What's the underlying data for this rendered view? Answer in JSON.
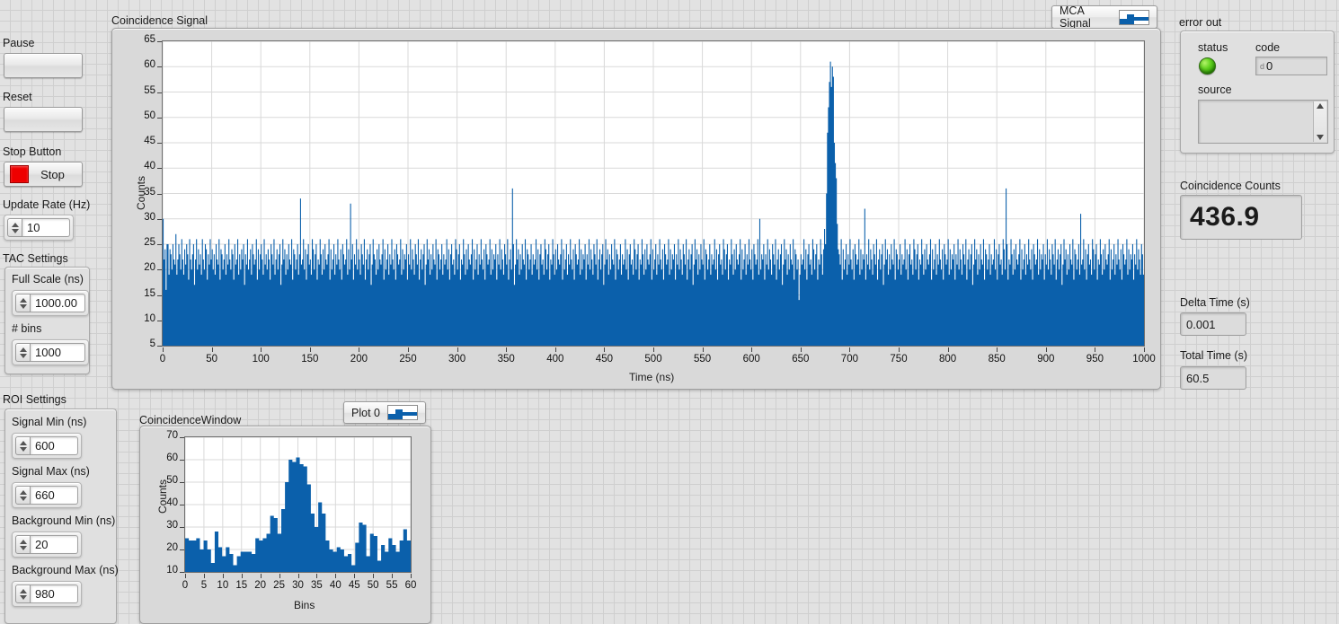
{
  "accent_color": "#0b60ab",
  "left_panel": {
    "pause": {
      "label": "Pause",
      "value": ""
    },
    "reset": {
      "label": "Reset",
      "value": ""
    },
    "stop": {
      "label": "Stop Button",
      "button_text": "Stop",
      "led_color": "#ee0000"
    },
    "update_rate": {
      "label": "Update Rate (Hz)",
      "value": "10"
    },
    "tac": {
      "label": "TAC Settings",
      "full_scale": {
        "label": "Full Scale (ns)",
        "value": "1000.00"
      },
      "bins": {
        "label": "# bins",
        "value": "1000"
      }
    },
    "roi": {
      "label": "ROI Settings",
      "signal_min": {
        "label": "Signal Min (ns)",
        "value": "600"
      },
      "signal_max": {
        "label": "Signal Max (ns)",
        "value": "660"
      },
      "background_min": {
        "label": "Background Min (ns)",
        "value": "20"
      },
      "background_max": {
        "label": "Background Max (ns)",
        "value": "980"
      }
    }
  },
  "right_panel": {
    "error_out": {
      "label": "error out",
      "status_label": "status",
      "status_value": "ok",
      "code_label": "code",
      "code_prefix": "d",
      "code_value": "0",
      "source_label": "source",
      "source_value": ""
    },
    "coincidence_counts": {
      "label": "Coincidence Counts",
      "value": "436.9"
    },
    "delta_time": {
      "label": "Delta Time (s)",
      "value": "0.001"
    },
    "total_time": {
      "label": "Total Time (s)",
      "value": "60.5"
    }
  },
  "main_graph": {
    "title": "Coincidence Signal",
    "legend": {
      "label": "MCA Signal"
    }
  },
  "sub_graph": {
    "title": "CoincidenceWindow",
    "legend": {
      "label": "Plot 0"
    }
  },
  "chart_data": [
    {
      "id": "coincidence-signal",
      "type": "bar",
      "title": "Coincidence Signal",
      "xlabel": "Time (ns)",
      "ylabel": "Counts",
      "xlim": [
        0,
        1000
      ],
      "ylim": [
        5,
        65
      ],
      "xticks": [
        0,
        50,
        100,
        150,
        200,
        250,
        300,
        350,
        400,
        450,
        500,
        550,
        600,
        650,
        700,
        750,
        800,
        850,
        900,
        950,
        1000
      ],
      "yticks": [
        5,
        10,
        15,
        20,
        25,
        30,
        35,
        40,
        45,
        50,
        55,
        60,
        65
      ],
      "grid": true,
      "legend": [
        "MCA Signal"
      ],
      "legend_position": "top-right-outside",
      "series_name": "MCA Signal",
      "color": "#0b60ab",
      "note": "1000-bin histogram: uniform background ~14-33 counts with a sharp coincidence peak near 630 ns reaching ~61 counts",
      "background_mean": 22,
      "background_min": 13,
      "background_max": 36,
      "peak": {
        "center_ns": 631,
        "height": 61,
        "fwhm_ns": 6
      },
      "values": [
        30,
        22,
        24,
        16,
        25,
        25,
        19,
        24,
        23,
        20,
        25,
        22,
        21,
        27,
        19,
        22,
        25,
        23,
        20,
        26,
        22,
        19,
        24,
        21,
        25,
        23,
        18,
        26,
        22,
        20,
        23,
        25,
        17,
        22,
        26,
        20,
        24,
        21,
        23,
        19,
        26,
        22,
        20,
        25,
        24,
        18,
        23,
        21,
        26,
        22,
        24,
        20,
        23,
        19,
        25,
        22,
        21,
        26,
        18,
        24,
        23,
        20,
        22,
        25,
        19,
        23,
        21,
        26,
        22,
        20,
        24,
        23,
        18,
        25,
        21,
        22,
        26,
        19,
        23,
        20,
        24,
        22,
        25,
        17,
        23,
        21,
        26,
        20,
        22,
        24,
        19,
        25,
        23,
        21,
        22,
        26,
        18,
        24,
        20,
        23,
        25,
        22,
        19,
        26,
        21,
        23,
        20,
        24,
        22,
        18,
        25,
        23,
        21,
        26,
        19,
        22,
        24,
        20,
        23,
        25,
        17,
        21,
        26,
        22,
        24,
        19,
        23,
        20,
        25,
        22,
        21,
        26,
        18,
        24,
        23,
        20,
        22,
        25,
        19,
        23,
        34,
        21,
        22,
        26,
        20,
        24,
        18,
        23,
        25,
        21,
        22,
        19,
        26,
        24,
        20,
        23,
        25,
        18,
        22,
        21,
        26,
        23,
        19,
        24,
        20,
        25,
        22,
        21,
        23,
        26,
        18,
        24,
        20,
        22,
        25,
        19,
        23,
        21,
        26,
        22,
        20,
        24,
        18,
        25,
        23,
        21,
        22,
        26,
        19,
        24,
        20,
        33,
        22,
        25,
        18,
        23,
        21,
        26,
        20,
        24,
        22,
        19,
        25,
        23,
        21,
        26,
        18,
        22,
        24,
        20,
        23,
        25,
        17,
        21,
        26,
        23,
        22,
        19,
        24,
        20,
        25,
        22,
        21,
        23,
        26,
        18,
        24,
        20,
        22,
        25,
        19,
        23,
        21,
        26,
        22,
        20,
        24,
        18,
        25,
        23,
        21,
        22,
        26,
        19,
        24,
        20,
        23,
        22,
        25,
        18,
        23,
        21,
        26,
        20,
        24,
        22,
        19,
        25,
        23,
        21,
        26,
        18,
        22,
        24,
        20,
        23,
        25,
        17,
        21,
        26,
        22,
        24,
        19,
        23,
        20,
        25,
        22,
        21,
        26,
        18,
        24,
        23,
        20,
        22,
        25,
        19,
        23,
        21,
        22,
        26,
        20,
        24,
        18,
        23,
        25,
        21,
        22,
        19,
        26,
        24,
        20,
        23,
        25,
        18,
        22,
        21,
        26,
        23,
        19,
        24,
        20,
        25,
        22,
        21,
        23,
        26,
        18,
        24,
        20,
        22,
        25,
        19,
        23,
        21,
        26,
        22,
        20,
        24,
        18,
        25,
        23,
        21,
        22,
        26,
        19,
        24,
        20,
        23,
        22,
        25,
        18,
        23,
        21,
        26,
        20,
        24,
        22,
        19,
        25,
        23,
        21,
        26,
        18,
        22,
        24,
        20,
        36,
        25,
        17,
        21,
        26,
        22,
        24,
        19,
        23,
        20,
        25,
        22,
        21,
        26,
        18,
        24,
        23,
        20,
        22,
        25,
        19,
        23,
        21,
        22,
        26,
        20,
        24,
        18,
        23,
        25,
        21,
        22,
        19,
        26,
        24,
        20,
        23,
        25,
        18,
        22,
        21,
        26,
        23,
        19,
        24,
        20,
        25,
        22,
        21,
        23,
        26,
        18,
        24,
        20,
        22,
        25,
        19,
        23,
        21,
        26,
        22,
        20,
        24,
        18,
        25,
        23,
        21,
        22,
        26,
        19,
        24,
        20,
        23,
        22,
        25,
        18,
        23,
        21,
        26,
        20,
        24,
        22,
        19,
        25,
        23,
        21,
        26,
        18,
        22,
        24,
        20,
        23,
        25,
        17,
        21,
        26,
        22,
        24,
        19,
        23,
        20,
        25,
        22,
        21,
        26,
        18,
        24,
        23,
        20,
        22,
        25,
        19,
        23,
        21,
        22,
        26,
        20,
        24,
        18,
        23,
        25,
        21,
        22,
        19,
        26,
        24,
        20,
        23,
        25,
        18,
        22,
        21,
        26,
        23,
        19,
        24,
        20,
        25,
        22,
        21,
        23,
        26,
        18,
        24,
        20,
        22,
        25,
        19,
        23,
        21,
        26,
        22,
        20,
        24,
        18,
        25,
        23,
        21,
        22,
        26,
        19,
        24,
        20,
        23,
        22,
        25,
        18,
        23,
        21,
        26,
        20,
        24,
        22,
        19,
        25,
        23,
        21,
        26,
        18,
        22,
        24,
        20,
        23,
        25,
        17,
        21,
        26,
        22,
        24,
        19,
        23,
        20,
        25,
        22,
        21,
        26,
        18,
        24,
        23,
        20,
        22,
        25,
        19,
        23,
        21,
        22,
        26,
        20,
        24,
        18,
        23,
        25,
        21,
        22,
        19,
        26,
        24,
        20,
        23,
        25,
        18,
        22,
        21,
        26,
        23,
        19,
        24,
        20,
        25,
        22,
        21,
        23,
        26,
        18,
        24,
        20,
        22,
        25,
        19,
        23,
        21,
        26,
        22,
        20,
        24,
        18,
        25,
        23,
        21,
        22,
        26,
        19,
        30,
        20,
        23,
        22,
        25,
        18,
        23,
        21,
        26,
        20,
        24,
        22,
        19,
        25,
        23,
        21,
        26,
        18,
        22,
        24,
        20,
        23,
        25,
        17,
        21,
        26,
        22,
        24,
        19,
        23,
        20,
        25,
        22,
        21,
        26,
        18,
        24,
        23,
        20,
        22,
        14,
        19,
        23,
        21,
        22,
        26,
        20,
        24,
        18,
        23,
        25,
        21,
        22,
        19,
        26,
        24,
        20,
        23,
        25,
        18,
        22,
        21,
        26,
        23,
        19,
        24,
        28,
        25,
        35,
        47,
        52,
        57,
        61,
        56,
        60,
        58,
        45,
        41,
        38,
        29,
        24,
        23,
        21,
        26,
        18,
        24,
        20,
        22,
        25,
        19,
        23,
        21,
        26,
        22,
        20,
        24,
        18,
        25,
        23,
        21,
        22,
        26,
        19,
        24,
        20,
        23,
        22,
        32,
        18,
        23,
        21,
        26,
        20,
        24,
        22,
        19,
        25,
        23,
        21,
        26,
        18,
        22,
        24,
        20,
        23,
        25,
        17,
        21,
        26,
        22,
        24,
        19,
        23,
        20,
        25,
        22,
        21,
        26,
        18,
        24,
        23,
        20,
        22,
        25,
        19,
        23,
        21,
        22,
        26,
        20,
        24,
        18,
        23,
        25,
        21,
        22,
        19,
        26,
        24,
        20,
        23,
        25,
        18,
        22,
        21,
        26,
        23,
        19,
        24,
        20,
        25,
        22,
        21,
        23,
        26,
        18,
        24,
        20,
        22,
        25,
        19,
        23,
        21,
        26,
        22,
        20,
        24,
        18,
        25,
        23,
        21,
        22,
        26,
        19,
        24,
        20,
        23,
        22,
        25,
        18,
        23,
        21,
        26,
        20,
        24,
        22,
        19,
        25,
        23,
        21,
        26,
        18,
        22,
        24,
        20,
        23,
        25,
        17,
        21,
        26,
        22,
        24,
        19,
        23,
        20,
        25,
        22,
        21,
        26,
        18,
        24,
        23,
        20,
        22,
        25,
        19,
        23,
        21,
        22,
        26,
        20,
        24,
        18,
        23,
        25,
        21,
        22,
        19,
        26,
        24,
        20,
        36,
        25,
        18,
        22,
        21,
        26,
        23,
        19,
        24,
        20,
        25,
        22,
        21,
        23,
        26,
        18,
        24,
        20,
        22,
        25,
        19,
        23,
        21,
        26,
        22,
        20,
        24,
        18,
        25,
        23,
        21,
        22,
        26,
        19,
        24,
        20,
        23,
        22,
        25,
        18,
        23,
        21,
        26,
        20,
        24,
        22,
        19,
        25,
        23,
        21,
        26,
        18,
        22,
        24,
        20,
        23,
        25,
        17,
        21,
        26,
        22,
        24,
        19,
        23,
        20,
        25,
        22,
        21,
        26,
        18,
        24,
        23,
        20,
        22,
        25,
        19,
        31,
        21,
        22,
        26,
        20,
        24,
        18,
        23,
        25,
        21,
        22,
        19,
        26,
        24,
        20,
        23,
        25,
        18,
        22,
        21,
        26,
        23,
        19,
        24,
        20,
        25,
        22,
        21,
        23,
        26,
        18,
        24,
        20,
        22,
        25,
        19,
        23,
        21,
        26,
        22,
        20,
        24,
        18,
        25,
        23,
        21,
        22,
        26,
        19,
        24,
        20,
        23,
        22,
        25,
        18,
        23,
        21,
        26,
        20,
        24,
        22,
        19,
        25,
        23,
        19
      ]
    },
    {
      "id": "coincidence-window",
      "type": "bar",
      "title": "CoincidenceWindow",
      "xlabel": "Bins",
      "ylabel": "Counts",
      "xlim": [
        0,
        60
      ],
      "ylim": [
        10,
        70
      ],
      "xticks": [
        0,
        5,
        10,
        15,
        20,
        25,
        30,
        35,
        40,
        45,
        50,
        55,
        60
      ],
      "yticks": [
        10,
        20,
        30,
        40,
        50,
        60,
        70
      ],
      "grid": true,
      "legend": [
        "Plot 0"
      ],
      "legend_position": "top-right-outside",
      "series_name": "Plot 0",
      "color": "#0b60ab",
      "categories": [
        0,
        1,
        2,
        3,
        4,
        5,
        6,
        7,
        8,
        9,
        10,
        11,
        12,
        13,
        14,
        15,
        16,
        17,
        18,
        19,
        20,
        21,
        22,
        23,
        24,
        25,
        26,
        27,
        28,
        29,
        30,
        31,
        32,
        33,
        34,
        35,
        36,
        37,
        38,
        39,
        40,
        41,
        42,
        43,
        44,
        45,
        46,
        47,
        48,
        49,
        50,
        51,
        52,
        53,
        54,
        55,
        56,
        57,
        58,
        59,
        60
      ],
      "values": [
        25,
        24,
        24,
        25,
        20,
        24,
        20,
        14,
        28,
        21,
        17,
        21,
        18,
        13,
        17,
        19,
        19,
        19,
        18,
        25,
        24,
        25,
        27,
        35,
        34,
        27,
        38,
        50,
        60,
        59,
        61,
        58,
        57,
        49,
        36,
        30,
        41,
        36,
        24,
        20,
        19,
        21,
        20,
        17,
        18,
        13,
        23,
        32,
        31,
        17,
        27,
        26,
        15,
        22,
        19,
        25,
        22,
        19,
        24,
        29,
        24
      ]
    }
  ]
}
